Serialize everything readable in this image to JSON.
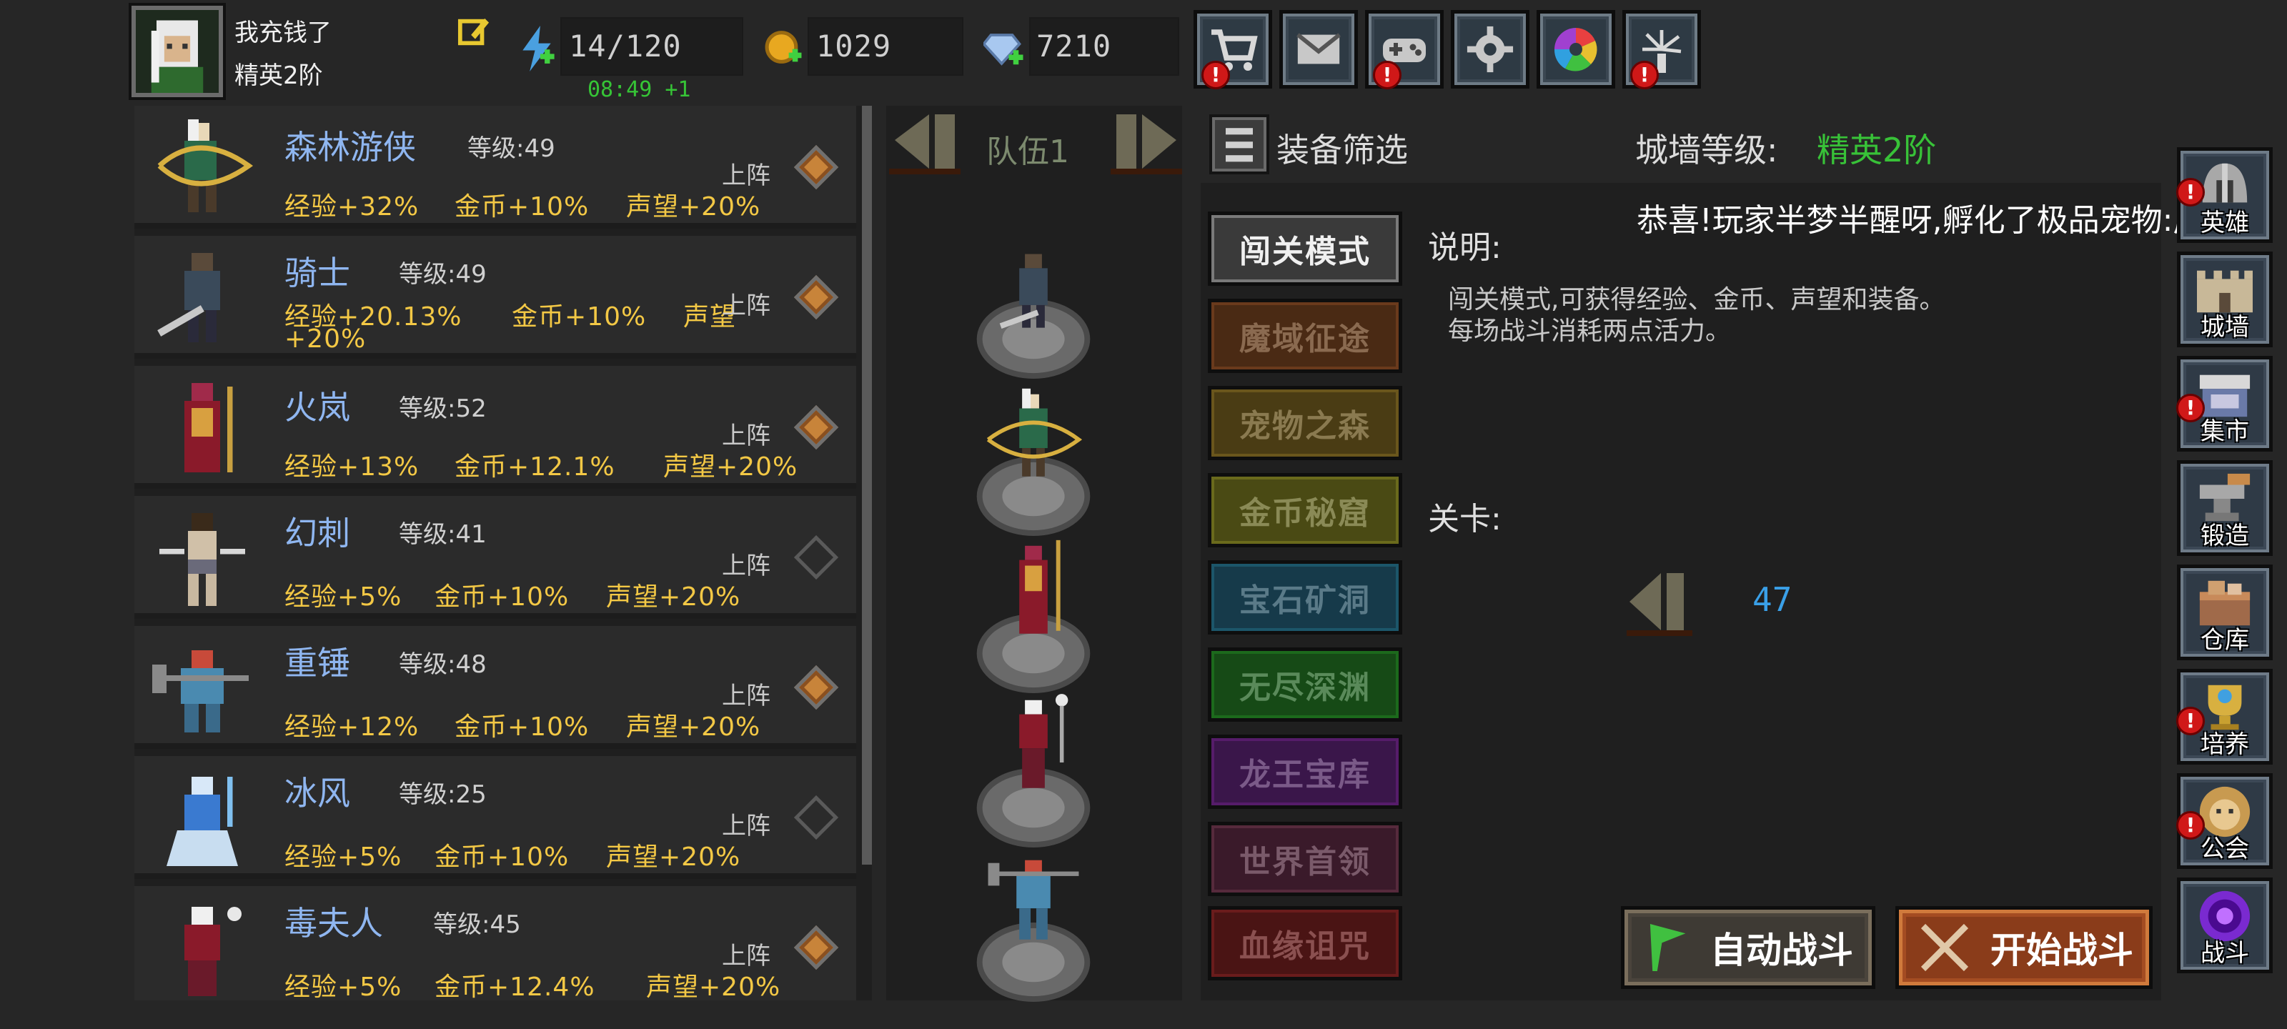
{
  "player": {
    "name": "我充钱了",
    "rank": "精英2阶"
  },
  "resources": {
    "energy": "14/120",
    "gold": "1029",
    "diamonds": "7210",
    "timer": "08:49 +1"
  },
  "top_icons": [
    "cart-icon",
    "mail-icon",
    "gamepad-icon",
    "settings-gear-icon",
    "color-wheel-icon",
    "fireworks-icon"
  ],
  "heroes": [
    {
      "name": "森林游侠",
      "level": "等级:49",
      "exp": "经验+32%",
      "gold": "金币+10%",
      "fame": "声望+20%",
      "deploy": "上阵",
      "deployed": true
    },
    {
      "name": "骑士",
      "level": "等级:49",
      "exp": "经验+20.13%",
      "gold": "金币+10%",
      "fame": "声望",
      "fame2": "+20%",
      "deploy": "上阵",
      "deployed": true
    },
    {
      "name": "火岚",
      "level": "等级:52",
      "exp": "经验+13%",
      "gold": "金币+12.1%",
      "fame": "声望+20%",
      "deploy": "上阵",
      "deployed": true
    },
    {
      "name": "幻刺",
      "level": "等级:41",
      "exp": "经验+5%",
      "gold": "金币+10%",
      "fame": "声望+20%",
      "deploy": "上阵",
      "deployed": false
    },
    {
      "name": "重锤",
      "level": "等级:48",
      "exp": "经验+12%",
      "gold": "金币+10%",
      "fame": "声望+20%",
      "deploy": "上阵",
      "deployed": true
    },
    {
      "name": "冰风",
      "level": "等级:25",
      "exp": "经验+5%",
      "gold": "金币+10%",
      "fame": "声望+20%",
      "deploy": "上阵",
      "deployed": false
    },
    {
      "name": "毒夫人",
      "level": "等级:45",
      "exp": "经验+5%",
      "gold": "金币+12.4%",
      "fame": "声望+20%",
      "deploy": "上阵",
      "deployed": true
    }
  ],
  "team": {
    "label": "队伍1"
  },
  "filter": {
    "label": "装备筛选"
  },
  "wall": {
    "label": "城墙等级:",
    "value": "精英2阶"
  },
  "broadcast": "恭喜!玩家半梦半醒呀,孵化了极品宠物:辰龙",
  "modes": [
    {
      "label": "闯关模式",
      "bg": "#3a3a3a",
      "fg": "#f0f0f0"
    },
    {
      "label": "魔域征途",
      "bg": "#4a2a14",
      "fg": "#8a6a50"
    },
    {
      "label": "宠物之森",
      "bg": "#4a3c14",
      "fg": "#8a7a50"
    },
    {
      "label": "金币秘窟",
      "bg": "#4a4a14",
      "fg": "#8a8a56"
    },
    {
      "label": "宝石矿洞",
      "bg": "#163a4a",
      "fg": "#5a7a88"
    },
    {
      "label": "无尽深渊",
      "bg": "#164a16",
      "fg": "#5a8a5a"
    },
    {
      "label": "龙王宝库",
      "bg": "#3a164a",
      "fg": "#7a5a88"
    },
    {
      "label": "世界首领",
      "bg": "#3a1a2a",
      "fg": "#7a5a6a"
    },
    {
      "label": "血缘诅咒",
      "bg": "#4a1414",
      "fg": "#8a5050"
    }
  ],
  "description": {
    "title": "说明:",
    "line1": "闯关模式,可获得经验、金币、声望和装备。",
    "line2": "每场战斗消耗两点活力。"
  },
  "stage": {
    "title": "关卡:",
    "number": "47"
  },
  "actions": {
    "auto": "自动战斗",
    "start": "开始战斗"
  },
  "side_nav": [
    {
      "label": "英雄",
      "icon": "helmet-icon",
      "alert": false
    },
    {
      "label": "城墙",
      "icon": "castle-wall-icon",
      "alert": false
    },
    {
      "label": "集市",
      "icon": "market-stall-icon",
      "alert": true
    },
    {
      "label": "锻造",
      "icon": "anvil-icon",
      "alert": false
    },
    {
      "label": "仓库",
      "icon": "storage-crate-icon",
      "alert": false
    },
    {
      "label": "培养",
      "icon": "trophy-cup-icon",
      "alert": true
    },
    {
      "label": "公会",
      "icon": "guild-lion-icon",
      "alert": true
    },
    {
      "label": "战斗",
      "icon": "battle-portal-icon",
      "alert": false
    }
  ]
}
